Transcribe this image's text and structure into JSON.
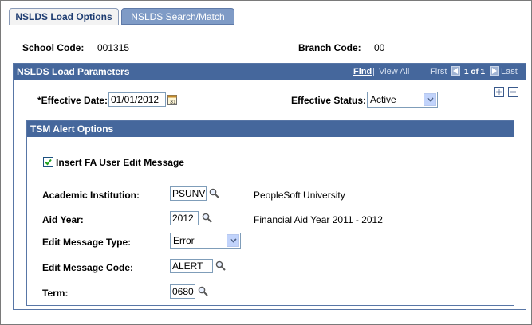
{
  "tabs": [
    {
      "label": "NSLDS Load Options",
      "active": true
    },
    {
      "label": "NSLDS Search/Match",
      "active": false
    }
  ],
  "header": {
    "school_code_label": "School Code:",
    "school_code_value": "001315",
    "branch_code_label": "Branch Code:",
    "branch_code_value": "00"
  },
  "load_parameters": {
    "title": "NSLDS Load Parameters",
    "nav": {
      "find": "Find",
      "separator": "|",
      "view_all": "View All",
      "first": "First",
      "count": "1 of 1",
      "last": "Last"
    },
    "effective_date_label": "*Effective Date:",
    "effective_date_value": "01/01/2012",
    "effective_status_label": "Effective Status:",
    "effective_status_value": "Active"
  },
  "tsm_alert": {
    "title": "TSM Alert Options",
    "insert_message_label": "Insert FA User Edit Message",
    "insert_message_checked": true,
    "academic_institution_label": "Academic Institution:",
    "academic_institution_value": "PSUNV",
    "academic_institution_desc": "PeopleSoft University",
    "aid_year_label": "Aid Year:",
    "aid_year_value": "2012",
    "aid_year_desc": "Financial Aid Year 2011 - 2012",
    "edit_message_type_label": "Edit Message Type:",
    "edit_message_type_value": "Error",
    "edit_message_code_label": "Edit Message Code:",
    "edit_message_code_value": "ALERT",
    "term_label": "Term:",
    "term_value": "0680"
  },
  "icons": {
    "lookup": "magnifier-icon",
    "calendar": "calendar-icon",
    "add_row": "plus-icon",
    "delete_row": "minus-icon"
  },
  "colors": {
    "header_blue": "#45679c",
    "tab_inactive": "#7f9bc6",
    "tab_active_text": "#1f3d72"
  }
}
